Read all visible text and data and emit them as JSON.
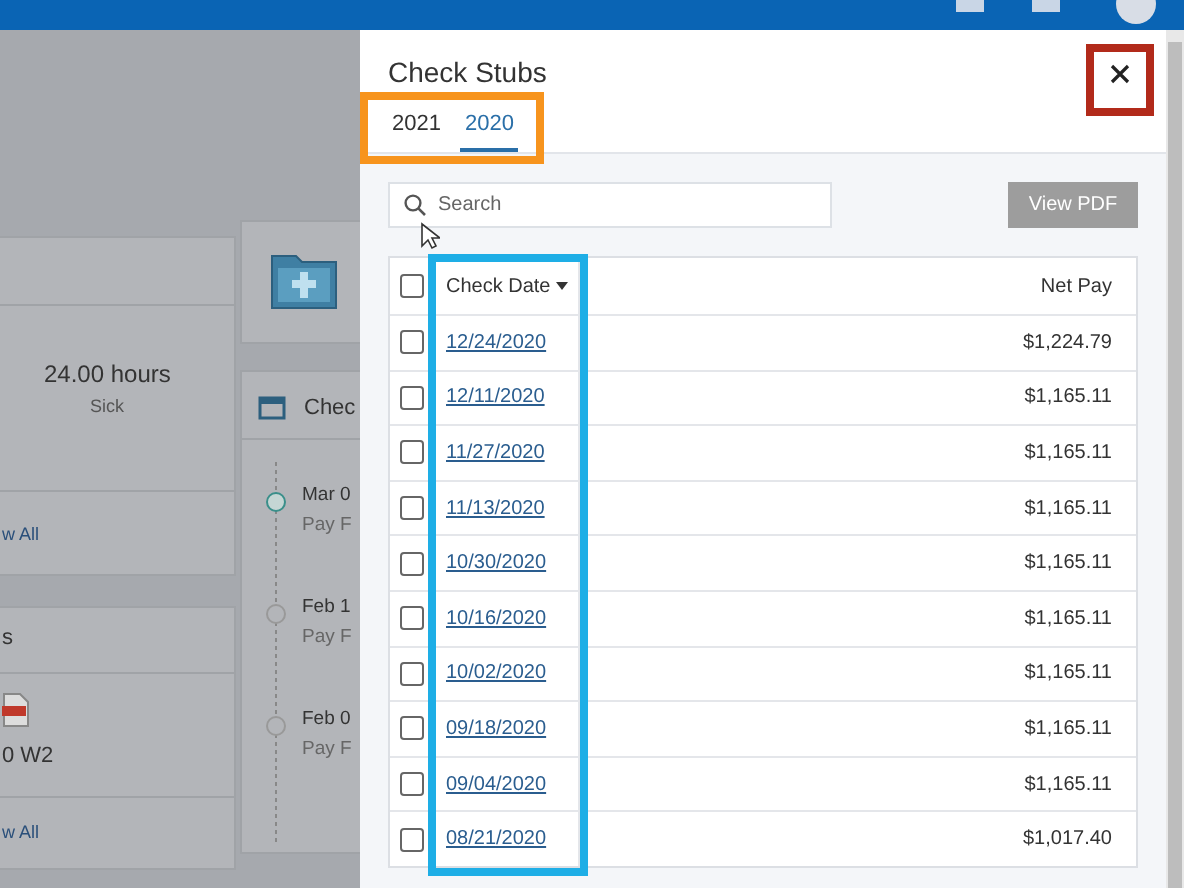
{
  "background": {
    "leave_card": {
      "hours": "24.00 hours",
      "type": "Sick",
      "link": "w All"
    },
    "documents_card": {
      "title": "s",
      "file": "0 W2",
      "link": "w All"
    },
    "pay_card": {
      "title": "Chec",
      "events": [
        {
          "date": "Mar 0",
          "label": "Pay F",
          "selected": true
        },
        {
          "date": "Feb 1",
          "label": "Pay F",
          "selected": false
        },
        {
          "date": "Feb 0",
          "label": "Pay F",
          "selected": false
        }
      ]
    }
  },
  "panel": {
    "title": "Check Stubs",
    "tabs": [
      {
        "label": "2021",
        "selected": false
      },
      {
        "label": "2020",
        "selected": true
      }
    ],
    "search": {
      "placeholder": "Search"
    },
    "view_pdf": {
      "label": "View PDF",
      "disabled": true
    },
    "table": {
      "select_all_checked": false,
      "columns": [
        "Check Date",
        "Net Pay"
      ],
      "rows": [
        {
          "checked": false,
          "date": "12/24/2020",
          "net_pay": "$1,224.79"
        },
        {
          "checked": false,
          "date": "12/11/2020",
          "net_pay": "$1,165.11"
        },
        {
          "checked": false,
          "date": "11/27/2020",
          "net_pay": "$1,165.11"
        },
        {
          "checked": false,
          "date": "11/13/2020",
          "net_pay": "$1,165.11"
        },
        {
          "checked": false,
          "date": "10/30/2020",
          "net_pay": "$1,165.11"
        },
        {
          "checked": false,
          "date": "10/16/2020",
          "net_pay": "$1,165.11"
        },
        {
          "checked": false,
          "date": "10/02/2020",
          "net_pay": "$1,165.11"
        },
        {
          "checked": false,
          "date": "09/18/2020",
          "net_pay": "$1,165.11"
        },
        {
          "checked": false,
          "date": "09/04/2020",
          "net_pay": "$1,165.11"
        },
        {
          "checked": false,
          "date": "08/21/2020",
          "net_pay": "$1,017.40"
        }
      ]
    }
  },
  "annotations": [
    {
      "kind": "tabs",
      "color": "#f7941d"
    },
    {
      "kind": "date-column",
      "color": "#1eaee6"
    },
    {
      "kind": "close",
      "color": "#b22a1a"
    }
  ]
}
